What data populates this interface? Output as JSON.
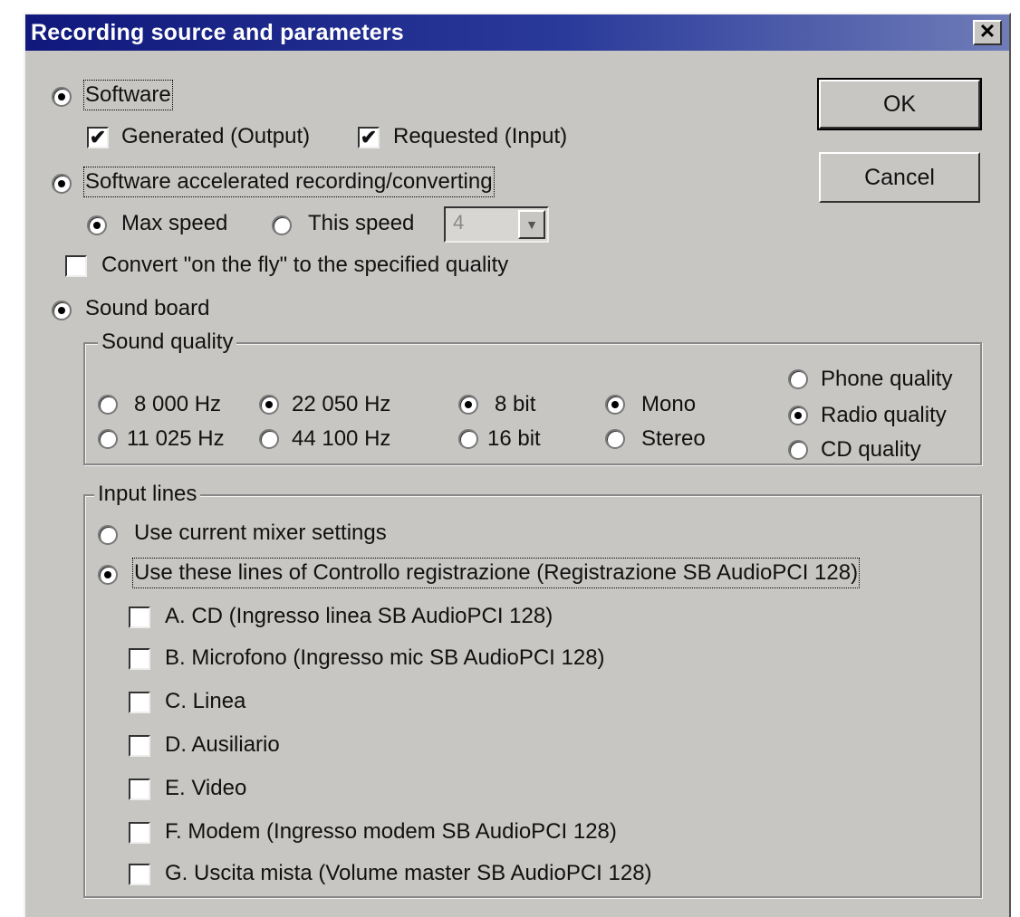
{
  "window": {
    "title": "Recording source and parameters",
    "close_glyph": "✕"
  },
  "buttons": {
    "ok": "OK",
    "cancel": "Cancel"
  },
  "software": {
    "label": "Software",
    "generated": "Generated (Output)",
    "requested": "Requested (Input)"
  },
  "accelerated": {
    "label": "Software accelerated recording/converting",
    "max_speed": "Max speed",
    "this_speed": "This speed",
    "speed_value": "4",
    "convert": "Convert \"on the fly\" to the specified quality"
  },
  "sound_board": {
    "label": "Sound board"
  },
  "sound_quality": {
    "legend": "Sound quality",
    "hz_8000": "8 000 Hz",
    "hz_11025": "11 025 Hz",
    "hz_22050": "22 050 Hz",
    "hz_44100": "44 100 Hz",
    "bit8": "8 bit",
    "bit16": "16 bit",
    "mono": "Mono",
    "stereo": "Stereo",
    "phone": "Phone quality",
    "radio": "Radio quality",
    "cd": "CD quality"
  },
  "input_lines": {
    "legend": "Input lines",
    "use_current": "Use current mixer settings",
    "use_these": "Use these lines of Controllo registrazione (Registrazione SB AudioPCI 128)",
    "lines": [
      "A. CD (Ingresso linea SB AudioPCI 128)",
      "B. Microfono (Ingresso mic SB AudioPCI 128)",
      "C. Linea",
      "D. Ausiliario",
      "E. Video",
      "F. Modem (Ingresso  modem SB AudioPCI 128)",
      "G. Uscita mista (Volume master SB AudioPCI 128)"
    ]
  },
  "icons": {
    "check": "✔",
    "dropdown": "▼"
  }
}
